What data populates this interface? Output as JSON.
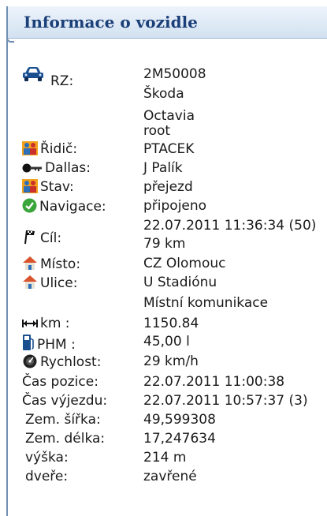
{
  "panel": {
    "title": "Informace o vozidle"
  },
  "vehicle": {
    "rz_label": "RZ:",
    "rz_value": "2M50008",
    "brand": "Škoda",
    "model": "Octavia",
    "user": "root",
    "driver_label": "Řidič:",
    "driver_value": "PTACEK",
    "dallas_label": "Dallas:",
    "dallas_value": "J Palík",
    "state_label": "Stav:",
    "state_value": "přejezd",
    "nav_label": "Navigace:",
    "nav_value": "připojeno",
    "target_label": "Cíl:",
    "target_time": "22.07.2011 11:36:34 (50)",
    "target_distance": "79 km",
    "place_label": "Místo:",
    "place_value": "CZ Olomouc",
    "street_label": "Ulice:",
    "street_value": "U Stadiónu",
    "street_type": "Místní komunikace",
    "km_label": "km :",
    "km_value": "1150.84",
    "fuel_label": "PHM :",
    "fuel_value": "45,00 l",
    "speed_label": "Rychlost:",
    "speed_value": "29 km/h",
    "pos_time_label": "Čas pozice:",
    "pos_time_value": "22.07.2011 11:00:38",
    "departure_label": "Čas výjezdu:",
    "departure_value": "22.07.2011 10:57:37 (3)",
    "lat_label": "Zem. šířka:",
    "lat_value": "49,599308",
    "lon_label": "Zem. délka:",
    "lon_value": "17,247634",
    "alt_label": "výška:",
    "alt_value": "214 m",
    "doors_label": "dveře:",
    "doors_value": "zavřené"
  },
  "icons": {
    "car": "car-icon",
    "driver": "driver-icon",
    "dallas": "key-icon",
    "state": "state-icon",
    "navigation": "check-icon",
    "target": "flag-icon",
    "place": "house-icon",
    "street": "house-icon",
    "km": "distance-icon",
    "fuel": "fuel-pump-icon",
    "speed": "speedometer-icon"
  },
  "colors": {
    "header_text": "#1b3f78",
    "panel_border": "#6f8fb4",
    "check_green": "#3aa53a",
    "house_roof": "#d9532c"
  }
}
